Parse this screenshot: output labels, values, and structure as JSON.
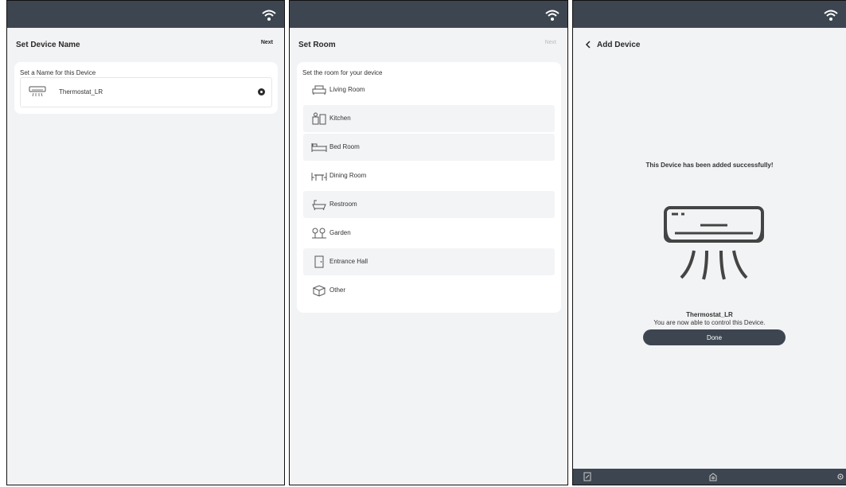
{
  "screen1": {
    "title": "Set Device Name",
    "next_label": "Next",
    "card_label": "Set a Name for this Device",
    "device_name_value": "Thermostat_LR"
  },
  "screen2": {
    "title": "Set Room",
    "next_label": "Next",
    "card_label": "Set the room for your device",
    "rooms": [
      {
        "label": "Living Room",
        "icon": "sofa-icon"
      },
      {
        "label": "Kitchen",
        "icon": "kitchen-icon"
      },
      {
        "label": "Bed Room",
        "icon": "bed-icon"
      },
      {
        "label": "Dining Room",
        "icon": "dining-table-icon"
      },
      {
        "label": "Restroom",
        "icon": "bathtub-icon"
      },
      {
        "label": "Garden",
        "icon": "garden-icon"
      },
      {
        "label": "Entrance Hall",
        "icon": "door-icon"
      },
      {
        "label": "Other",
        "icon": "box-icon"
      }
    ]
  },
  "screen3": {
    "title": "Add Device",
    "success_message": "This Device has been added successfully!",
    "device_name": "Thermostat_LR",
    "control_message": "You are now able to control this Device.",
    "done_label": "Done"
  },
  "colors": {
    "bar": "#3d4650",
    "background": "#f2f3f5",
    "card": "#ffffff"
  }
}
